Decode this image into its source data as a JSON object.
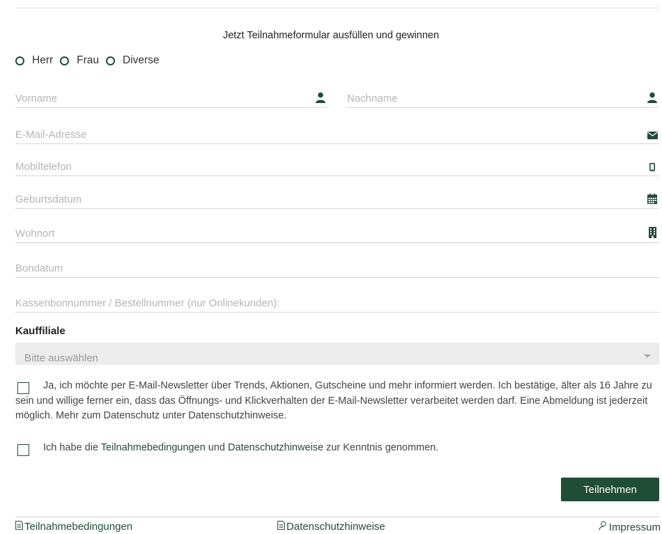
{
  "form": {
    "title": "Jetzt Teilnahmeformular ausfüllen und gewinnen",
    "salutation": [
      "Herr",
      "Frau",
      "Diverse"
    ],
    "fields": {
      "vorname": "Vorname",
      "nachname": "Nachname",
      "email": "E-Mail-Adresse",
      "mobil": "Mobiltelefon",
      "geburtsdatum": "Geburtsdatum",
      "wohnort": "Wohnort",
      "bondatum": "Bondatum",
      "bonnummer": "Kassenbonnummer / Bestellnummer (nur Onlinekunden):"
    },
    "kauffiliale_label": "Kauffiliale",
    "kauffiliale_value": "Bitte auswählen",
    "newsletter_text": "Ja, ich möchte per E-Mail-Newsletter über Trends, Aktionen, Gutscheine und mehr informiert werden. Ich bestätige, älter als 16 Jahre zu sein und willige ferner ein, dass das Öffnungs- und Klickverhalten der E-Mail-Newsletter verarbeitet werden darf. Eine Abmeldung ist jederzeit möglich. Mehr zum Datenschutz unter Datenschutzhinweise.",
    "terms": {
      "prefix": "Ich habe die",
      "link1": "Teilnahmebedingungen",
      "middle": "und",
      "link2": "Datenschutzhinweise",
      "suffix": "zur Kenntnis genommen."
    },
    "submit_label": "Teilnehmen"
  },
  "footer": {
    "teilnahme": "Teilnahmebedingungen",
    "datenschutz": "Datenschutzhinweise",
    "impressum": "Impressum"
  },
  "colors": {
    "accent": "#1f4d36",
    "placeholder": "#b5b5b5",
    "select_bg": "#ececec"
  },
  "icons": {
    "vorname": "user-icon",
    "nachname": "user-icon",
    "email": "envelope-icon",
    "mobil": "mobile-icon",
    "geburtsdatum": "calendar-icon",
    "wohnort": "building-icon",
    "footer_docs": "document-icon",
    "footer_impressum": "person-outline-icon"
  }
}
